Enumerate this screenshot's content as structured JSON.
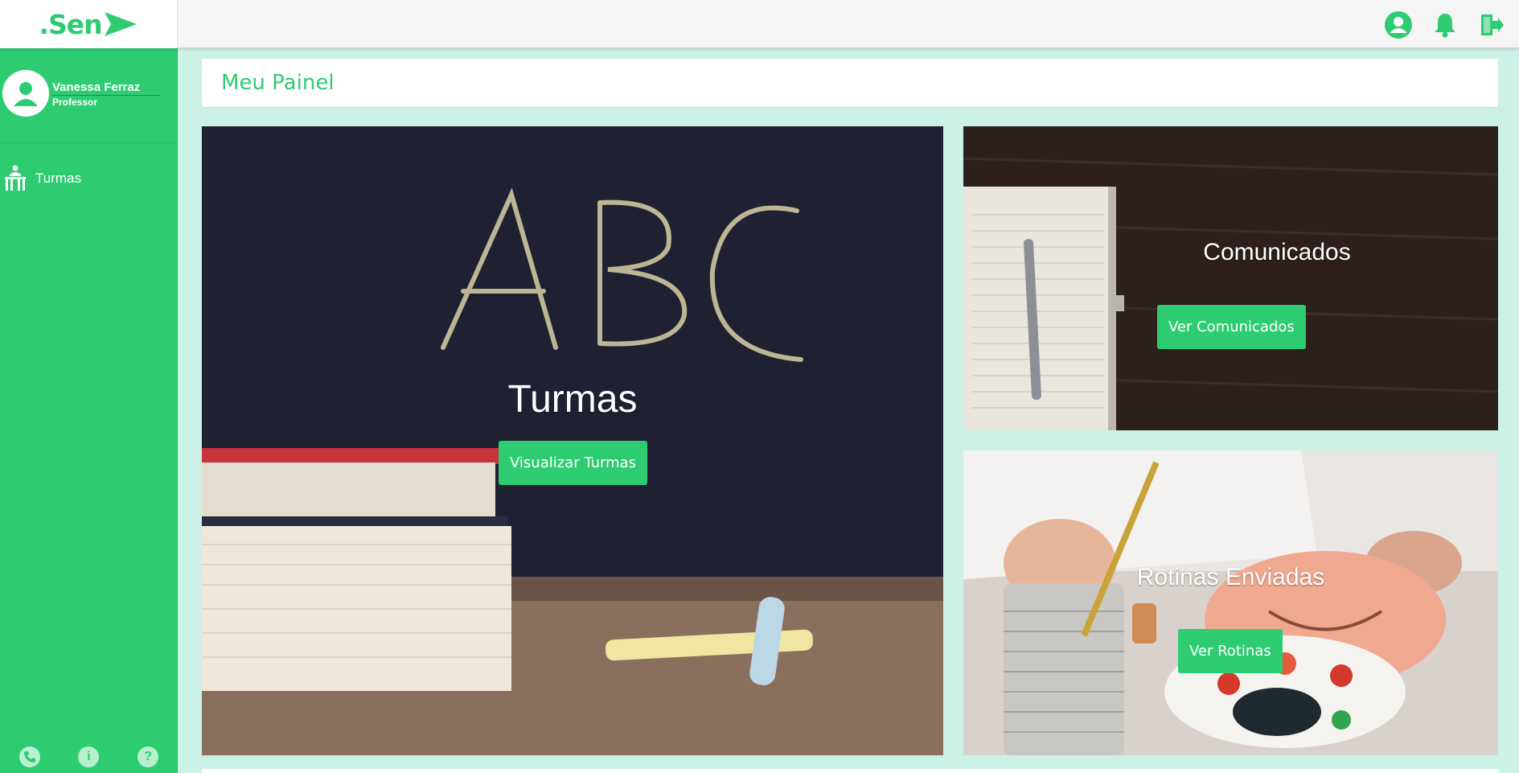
{
  "app": {
    "logo": ".Sen"
  },
  "topbar": {
    "icons": [
      "user-icon",
      "bell-icon",
      "logout-icon"
    ]
  },
  "sidebar": {
    "user": {
      "name": "Vanessa Ferraz",
      "role": "Professor"
    },
    "items": [
      {
        "label": "Turmas",
        "icon": "classroom-icon"
      }
    ],
    "footer_icons": [
      "phone-icon",
      "info-icon",
      "help-icon"
    ]
  },
  "main": {
    "title": "Meu Painel",
    "cards": {
      "turmas": {
        "title": "Turmas",
        "button": "Visualizar Turmas"
      },
      "comunicados": {
        "title": "Comunicados",
        "button": "Ver Comunicados"
      },
      "rotinas": {
        "title": "Rotinas Enviadas",
        "button": "Ver Rotinas"
      }
    }
  },
  "colors": {
    "accent": "#2ecc71",
    "background": "#ccf2e8",
    "topbar": "#f5f5f5"
  }
}
